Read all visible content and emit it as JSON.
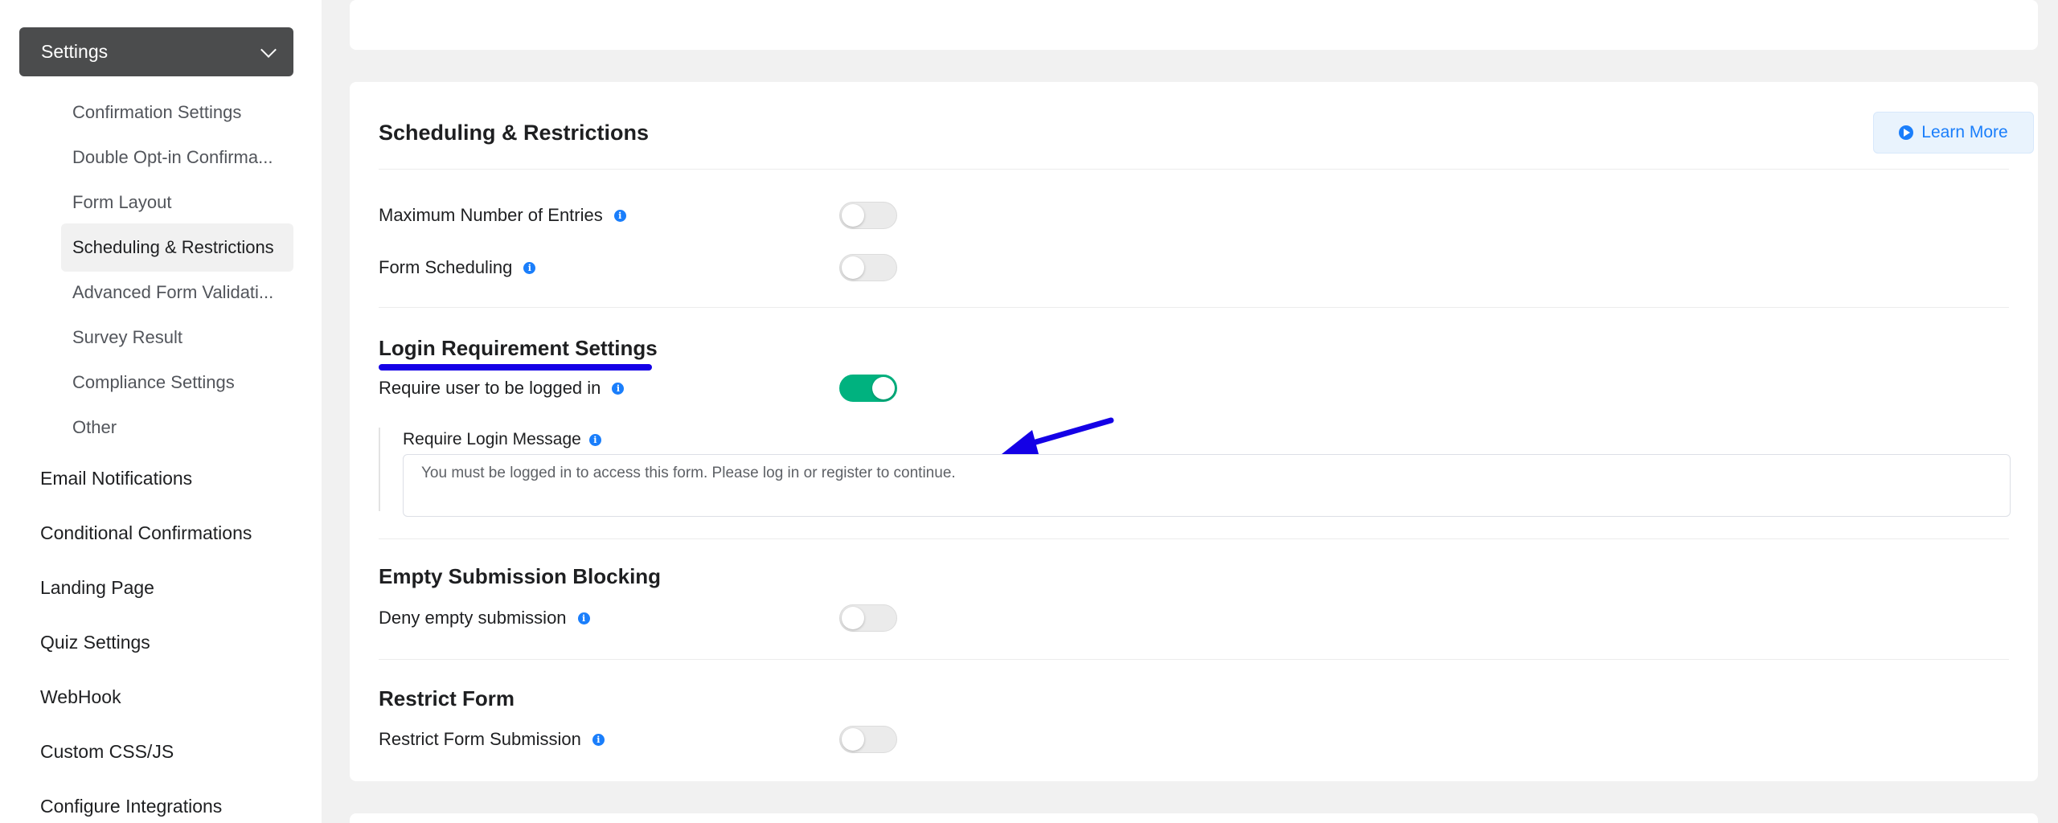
{
  "sidebar": {
    "settings_label": "Settings",
    "sub_items": [
      "Confirmation Settings",
      "Double Opt-in Confirma...",
      "Form Layout",
      "Scheduling & Restrictions",
      "Advanced Form Validati...",
      "Survey Result",
      "Compliance Settings",
      "Other"
    ],
    "active_sub_item": "Scheduling & Restrictions",
    "main_items": [
      "Email Notifications",
      "Conditional Confirmations",
      "Landing Page",
      "Quiz Settings",
      "WebHook",
      "Custom CSS/JS",
      "Configure Integrations"
    ]
  },
  "main": {
    "section_title": "Scheduling & Restrictions",
    "learn_more_label": "Learn More",
    "rows": {
      "max_entries": {
        "label": "Maximum Number of Entries",
        "on": false
      },
      "form_scheduling": {
        "label": "Form Scheduling",
        "on": false
      },
      "require_login": {
        "label": "Require user to be logged in",
        "on": true
      },
      "deny_empty": {
        "label": "Deny empty submission",
        "on": false
      },
      "restrict_submission": {
        "label": "Restrict Form Submission",
        "on": false
      }
    },
    "login_section_title": "Login Requirement Settings",
    "login_message_label": "Require Login Message",
    "login_message_value": "You must be logged in to access this form. Please log in or register to continue.",
    "empty_section_title": "Empty Submission Blocking",
    "restrict_section_title": "Restrict Form"
  },
  "colors": {
    "accent": "#1a7efb",
    "toggle_on": "#00b27f",
    "annotation": "#1400e6",
    "sidebar_header": "#4b4c4d"
  },
  "icons": {
    "info": "info-icon",
    "chevron": "chevron-down-icon",
    "play": "play-circle-icon"
  }
}
